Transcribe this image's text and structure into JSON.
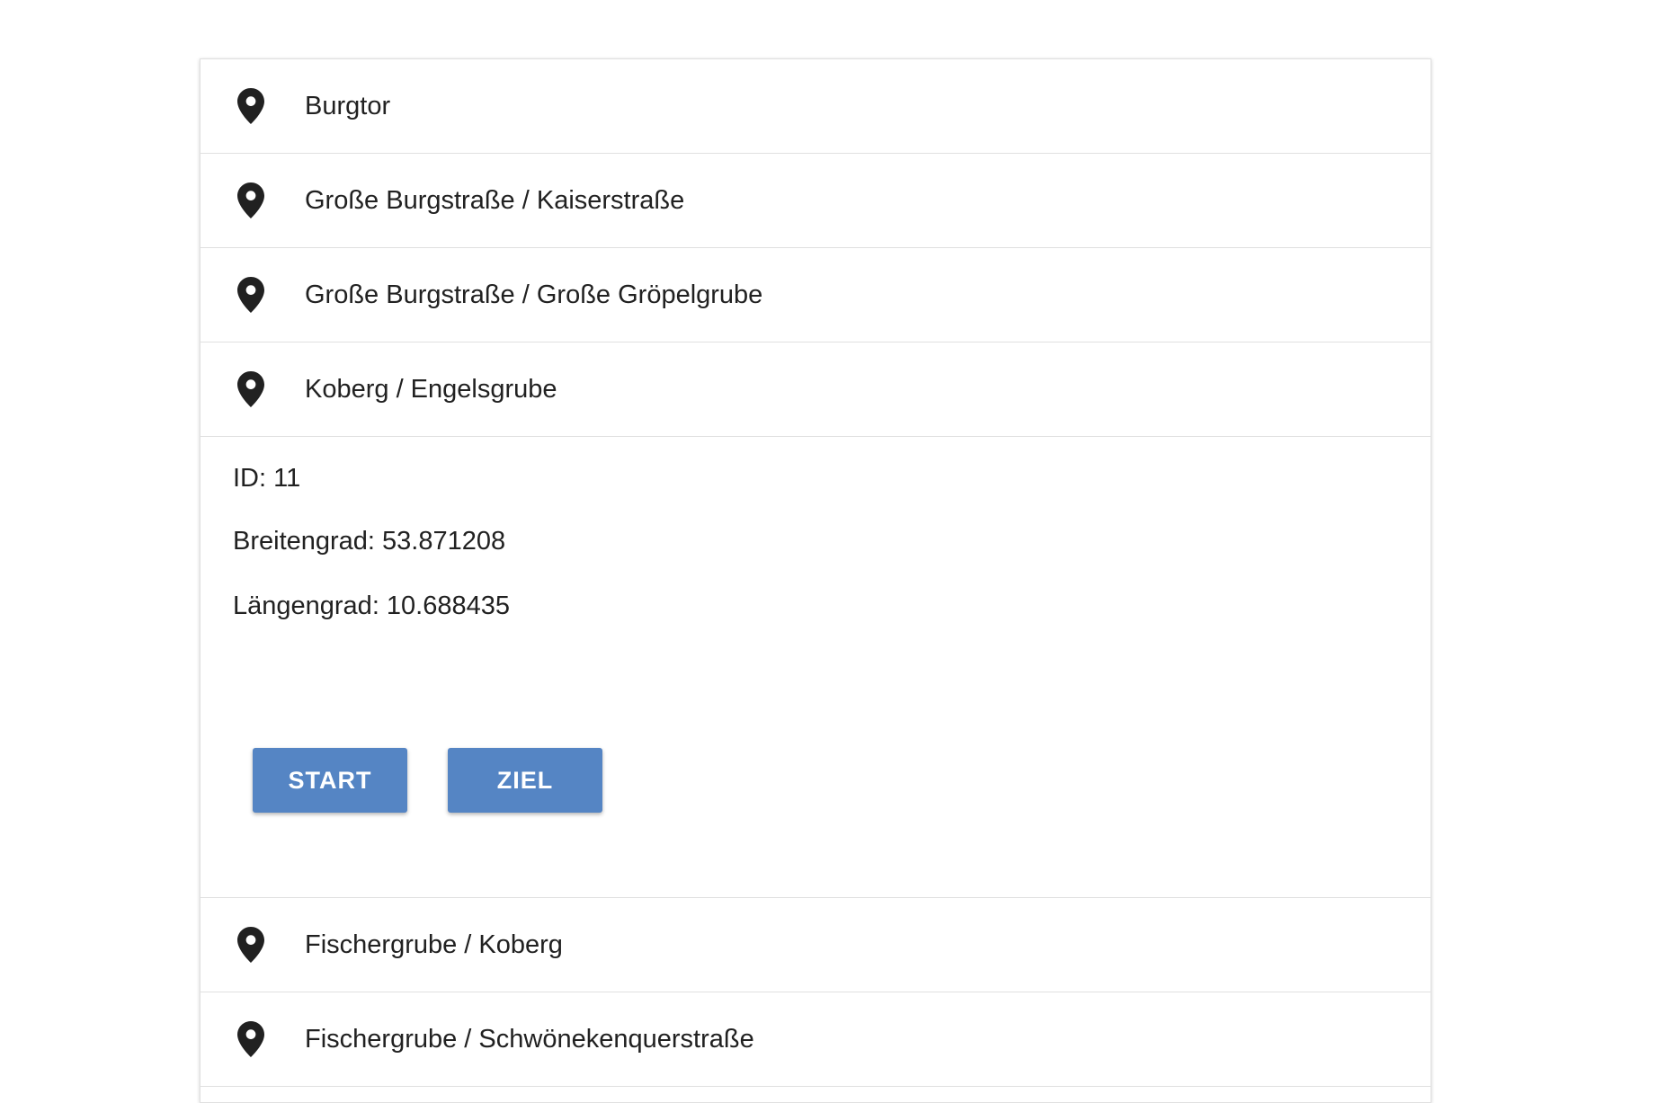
{
  "stops": [
    {
      "label": "Burgtor",
      "icon": "location-pin-icon"
    },
    {
      "label": "Große Burgstraße / Kaiserstraße",
      "icon": "location-pin-icon"
    },
    {
      "label": "Große Burgstraße / Große Gröpelgrube",
      "icon": "location-pin-icon"
    },
    {
      "label": "Koberg / Engelsgrube",
      "icon": "location-pin-icon"
    }
  ],
  "selected": {
    "id_line": "ID: 11",
    "latitude_line": "Breitengrad: 53.871208",
    "longitude_line": "Längengrad: 10.688435",
    "start_label": "START",
    "ziel_label": "ZIEL"
  },
  "more_stops": [
    {
      "label": "Fischergrube / Koberg",
      "icon": "location-pin-icon"
    },
    {
      "label": "Fischergrube / Schwönekenquerstraße",
      "icon": "location-pin-icon"
    }
  ],
  "colors": {
    "button": "#5585c4",
    "icon": "#212121",
    "divider": "#e0e0e0"
  }
}
